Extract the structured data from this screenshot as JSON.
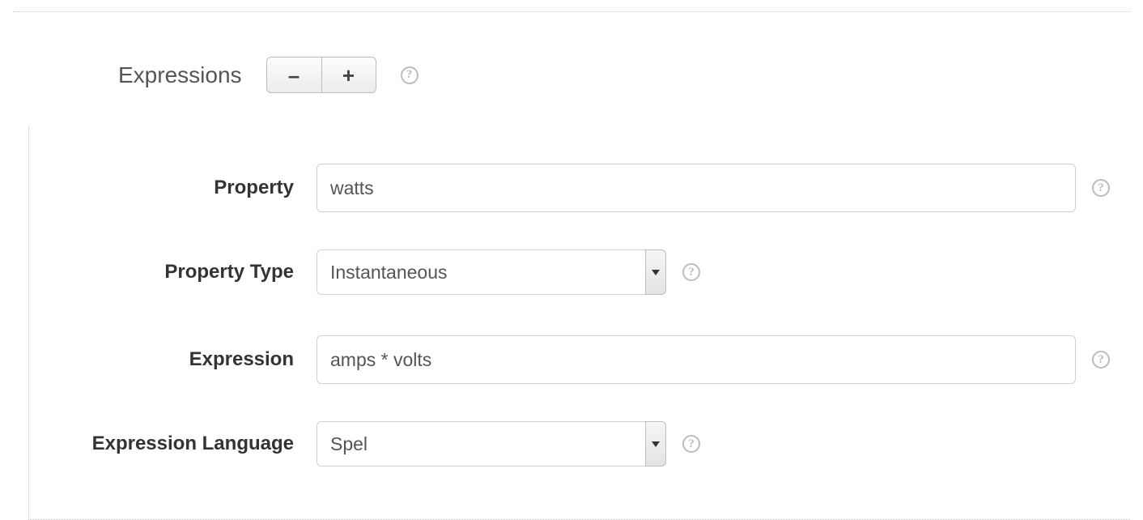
{
  "section": {
    "title": "Expressions"
  },
  "buttons": {
    "minus": "–",
    "plus": "+"
  },
  "help_glyph": "?",
  "fields": {
    "property": {
      "label": "Property",
      "value": "watts"
    },
    "property_type": {
      "label": "Property Type",
      "value": "Instantaneous"
    },
    "expression": {
      "label": "Expression",
      "value": "amps * volts"
    },
    "expression_language": {
      "label": "Expression Language",
      "value": "Spel"
    }
  }
}
